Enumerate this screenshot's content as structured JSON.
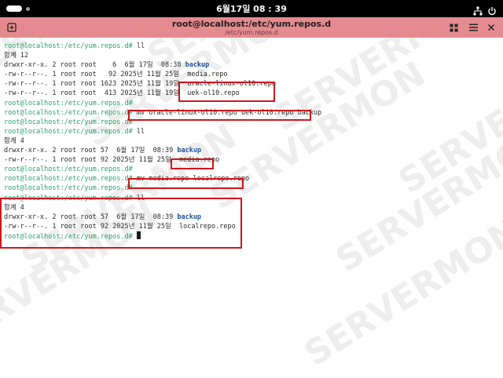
{
  "topbar": {
    "clock": "6월17일  08 : 39",
    "network_icon": "network-wired-icon",
    "power_icon": "power-icon"
  },
  "window": {
    "title": "root@localhost:/etc/yum.repos.d",
    "subtitle": "/etc/yum.repos.d",
    "header_color": "#e58a8e"
  },
  "terminal": {
    "prompt": "root@localhost:/etc/yum.repos.d#",
    "lines": [
      {
        "prompt": "root@localhost:/etc/yum.repos.d#",
        "text": " ll"
      },
      {
        "text": "합계 12"
      },
      {
        "text": "drwxr-xr-x. 2 root root    6  6월 17일  08:38 ",
        "dir": "backup"
      },
      {
        "text": "-rw-r--r--. 1 root root   92 2025년 11월 25일  media.repo"
      },
      {
        "text": "-rw-r--r--. 1 root root 1623 2025년 11월 19일  oracle-linux-ol10.repo"
      },
      {
        "text": "-rw-r--r--. 1 root root  413 2025년 11월 19일  uek-ol10.repo"
      },
      {
        "prompt": "root@localhost:/etc/yum.repos.d#",
        "text": ""
      },
      {
        "prompt": "root@localhost:/etc/yum.repos.d#",
        "text": " mv oracle-linux-ol10.repo uek-ol10.repo backup"
      },
      {
        "prompt": "root@localhost:/etc/yum.repos.d#",
        "text": ""
      },
      {
        "prompt": "root@localhost:/etc/yum.repos.d#",
        "text": " ll"
      },
      {
        "text": "합계 4"
      },
      {
        "text": "drwxr-xr-x. 2 root root 57  6월 17일  08:39 ",
        "dir": "backup"
      },
      {
        "text": "-rw-r--r--. 1 root root 92 2025년 11월 25일  media.repo"
      },
      {
        "prompt": "root@localhost:/etc/yum.repos.d#",
        "text": ""
      },
      {
        "prompt": "root@localhost:/etc/yum.repos.d#",
        "text": " mv media.repo localrepo.repo"
      },
      {
        "prompt": "root@localhost:/etc/yum.repos.d#",
        "text": ""
      },
      {
        "prompt": "root@localhost:/etc/yum.repos.d#",
        "text": " ll"
      },
      {
        "text": "합계 4"
      },
      {
        "text": "drwxr-xr-x. 2 root root 57  6월 17일  08:39 ",
        "dir": "backup"
      },
      {
        "text": "-rw-r--r--. 1 root root 92 2025년 11월 25일  localrepo.repo"
      },
      {
        "prompt": "root@localhost:/etc/yum.repos.d#",
        "text": " ",
        "cursor": true
      }
    ],
    "watermark_text": "SERVERMON",
    "annotation_color": "#d0161b"
  }
}
